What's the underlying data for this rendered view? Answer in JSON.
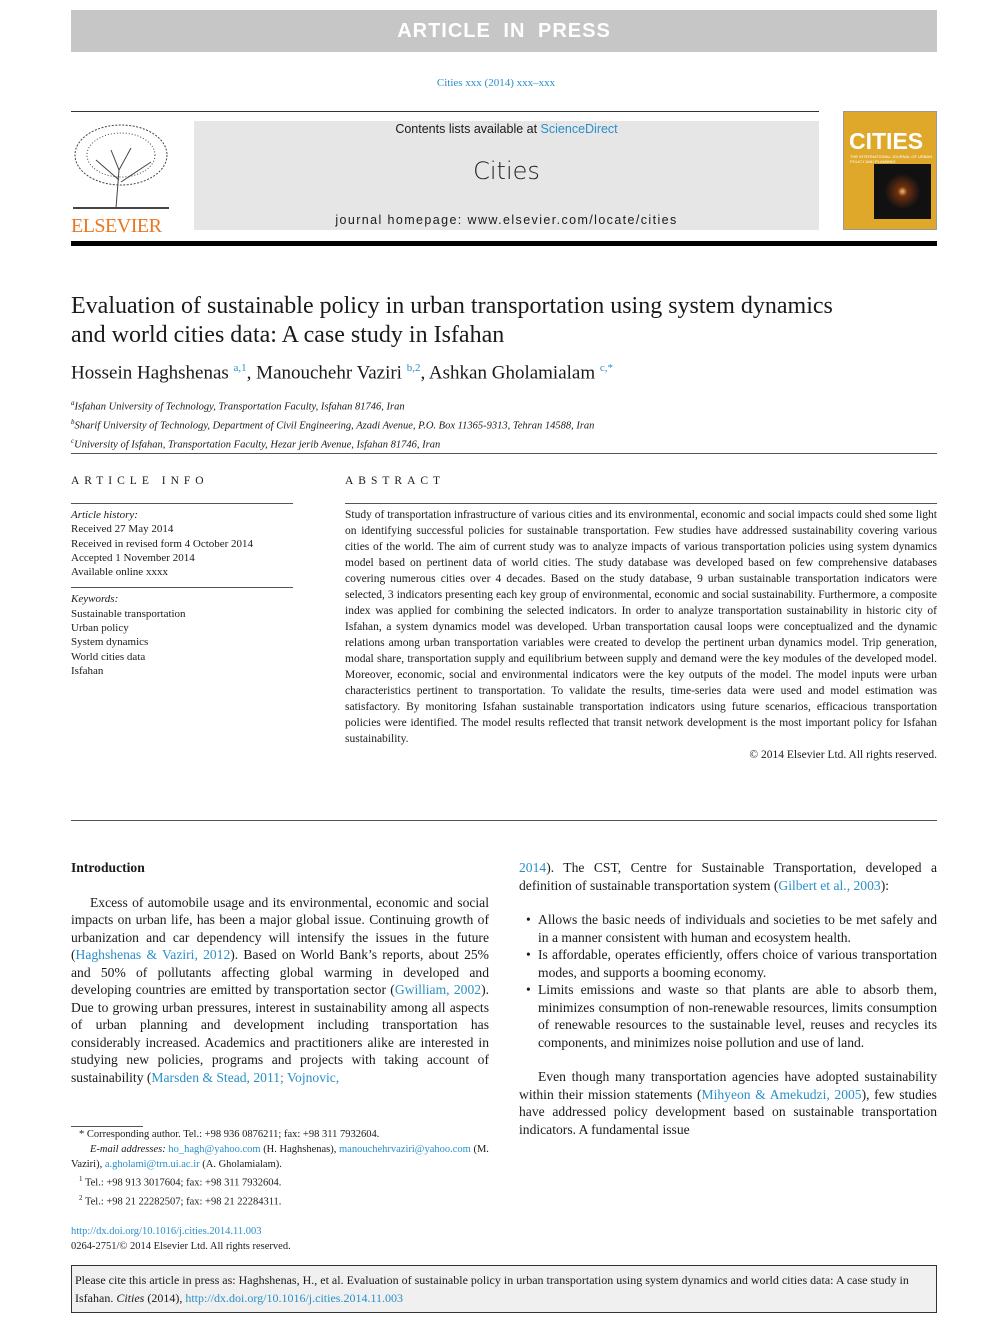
{
  "banner": "ARTICLE IN PRESS",
  "journal_ref": "Cities xxx (2014) xxx–xxx",
  "header": {
    "contents_prefix": "Contents lists available at ",
    "contents_link": "ScienceDirect",
    "journal": "Cities",
    "homepage": "journal homepage: www.elsevier.com/locate/cities",
    "publisher": "ELSEVIER",
    "cover_title": "CITIES",
    "cover_subtitle": "THE INTERNATIONAL JOURNAL OF URBAN POLICY AND PLANNING"
  },
  "title": "Evaluation of sustainable policy in urban transportation using system dynamics and world cities data: A case study in Isfahan",
  "authors": [
    {
      "name": "Hossein Haghshenas",
      "sup": "a,1"
    },
    {
      "name": "Manouchehr Vaziri",
      "sup": "b,2"
    },
    {
      "name": "Ashkan Gholamialam",
      "sup": "c,*"
    }
  ],
  "affiliations": [
    {
      "k": "a",
      "t": "Isfahan University of Technology, Transportation Faculty, Isfahan 81746, Iran"
    },
    {
      "k": "b",
      "t": "Sharif University of Technology, Department of Civil Engineering, Azadi Avenue, P.O. Box 11365-9313, Tehran 14588, Iran"
    },
    {
      "k": "c",
      "t": "University of Isfahan, Transportation Faculty, Hezar jerib Avenue, Isfahan 81746, Iran"
    }
  ],
  "article_info": {
    "heading": "ARTICLE INFO",
    "history_label": "Article history:",
    "history": [
      "Received 27 May 2014",
      "Received in revised form 4 October 2014",
      "Accepted 1 November 2014",
      "Available online xxxx"
    ],
    "keywords_label": "Keywords:",
    "keywords": [
      "Sustainable transportation",
      "Urban policy",
      "System dynamics",
      "World cities data",
      "Isfahan"
    ]
  },
  "abstract": {
    "heading": "ABSTRACT",
    "text": "Study of transportation infrastructure of various cities and its environmental, economic and social impacts could shed some light on identifying successful policies for sustainable transportation. Few studies have addressed sustainability covering various cities of the world. The aim of current study was to analyze impacts of various transportation policies using system dynamics model based on pertinent data of world cities. The study database was developed based on few comprehensive databases covering numerous cities over 4 decades. Based on the study database, 9 urban sustainable transportation indicators were selected, 3 indicators presenting each key group of environmental, economic and social sustainability. Furthermore, a composite index was applied for combining the selected indicators. In order to analyze transportation sustainability in historic city of Isfahan, a system dynamics model was developed. Urban transportation causal loops were conceptualized and the dynamic relations among urban transportation variables were created to develop the pertinent urban dynamics model. Trip generation, modal share, transportation supply and equilibrium between supply and demand were the key modules of the developed model. Moreover, economic, social and environmental indicators were the key outputs of the model. The model inputs were urban characteristics pertinent to transportation. To validate the results, time-series data were used and model estimation was satisfactory. By monitoring Isfahan sustainable transportation indicators using future scenarios, efficacious transportation policies were identified. The model results reflected that transit network development is the most important policy for Isfahan sustainability.",
    "copyright": "© 2014 Elsevier Ltd. All rights reserved."
  },
  "intro": {
    "heading": "Introduction",
    "p1": [
      {
        "t": "Excess of automobile usage and its environmental, economic and social impacts on urban life, has been a major global issue. Continuing growth of urbanization and car dependency will intensify the issues in the future ("
      },
      {
        "l": "Haghshenas & Vaziri, 2012"
      },
      {
        "t": "). Based on World Bank’s reports, about 25% and 50% of pollutants affecting global warming in developed and developing countries are emitted by transportation sector ("
      },
      {
        "l": "Gwilliam, 2002"
      },
      {
        "t": "). Due to growing urban pressures, interest in sustainability among all aspects of urban planning and development including transportation has considerably increased. Academics and practitioners alike are interested in studying new policies, programs and projects with taking account of sustainability ("
      },
      {
        "l": "Marsden & Stead, 2011; Vojnovic, 2014"
      },
      {
        "t": "). The CST, Centre for Sustainable Transportation, developed a definition of sustainable transportation system ("
      },
      {
        "l": "Gilbert et al., 2003"
      },
      {
        "t": "):"
      }
    ],
    "bullets": [
      "Allows the basic needs of individuals and societies to be met safely and in a manner consistent with human and ecosystem health.",
      "Is affordable, operates efficiently, offers choice of various transportation modes, and supports a booming economy.",
      "Limits emissions and waste so that plants are able to absorb them, minimizes consumption of non-renewable resources, limits consumption of renewable resources to the sustainable level, reuses and recycles its components, and minimizes noise pollution and use of land."
    ],
    "p2": [
      {
        "t": "Even though many transportation agencies have adopted sustainability within their mission statements ("
      },
      {
        "l": "Mihyeon & Amekudzi, 2005"
      },
      {
        "t": "), few studies have addressed policy development based on sustainable transportation indicators. A fundamental issue"
      }
    ]
  },
  "footnotes": {
    "corresponding": "Corresponding author. Tel.: +98 936 0876211; fax: +98 311 7932604.",
    "email_label": "E-mail addresses:",
    "email1": "ho_hagh@yahoo.com",
    "email1_who": " (H. Haghshenas), ",
    "email2": "manouchehrvaziri@yahoo.com",
    "email2_who": " (M. Vaziri), ",
    "email3": "a.gholami@trn.ui.ac.ir",
    "email3_who": " (A. Gholamialam).",
    "fn1": "Tel.: +98 913 3017604; fax: +98 311 7932604.",
    "fn2": "Tel.: +98 21 22282507; fax: +98 21 22284311.",
    "doi": "http://dx.doi.org/10.1016/j.cities.2014.11.003",
    "issn": "0264-2751/© 2014 Elsevier Ltd. All rights reserved."
  },
  "cite_box": {
    "prefix": "Please cite this article in press as: Haghshenas, H., et al. Evaluation of sustainable policy in urban transportation using system dynamics and world cities data: A case study in Isfahan. ",
    "journal": "Cities",
    "year": " (2014), ",
    "doi": "http://dx.doi.org/10.1016/j.cities.2014.11.003"
  }
}
